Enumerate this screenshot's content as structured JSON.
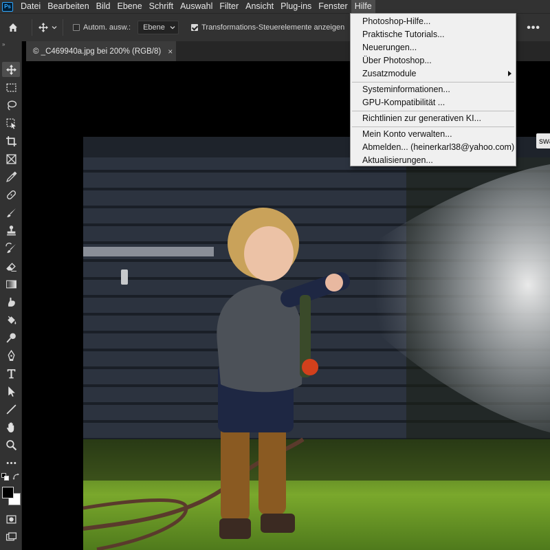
{
  "app": {
    "logo": "Ps"
  },
  "menubar": {
    "items": [
      "Datei",
      "Bearbeiten",
      "Bild",
      "Ebene",
      "Schrift",
      "Auswahl",
      "Filter",
      "Ansicht",
      "Plug-ins",
      "Fenster",
      "Hilfe"
    ],
    "active": "Hilfe"
  },
  "options": {
    "auto_select_label": "Autom. ausw.:",
    "auto_select_checked": false,
    "layer_select_value": "Ebene",
    "transform_controls_label": "Transformations-Steuerelemente anzeigen",
    "transform_controls_checked": true,
    "more_label": "•••"
  },
  "tab": {
    "title": "© _C469940a.jpg bei 200% (RGB/8)",
    "close": "×"
  },
  "canvas": {
    "partial_button_label": "swählen"
  },
  "help_menu": {
    "items": [
      {
        "label": "Photoshop-Hilfe..."
      },
      {
        "label": "Praktische Tutorials..."
      },
      {
        "label": "Neuerungen..."
      },
      {
        "label": "Über Photoshop..."
      },
      {
        "label": "Zusatzmodule",
        "submenu": true
      },
      {
        "label": "Systeminformationen..."
      },
      {
        "label": "GPU-Kompatibilität ..."
      },
      {
        "label": "Richtlinien zur generativen KI..."
      },
      {
        "label": "Mein Konto verwalten..."
      },
      {
        "label": "Abmelden... (heinerkarl38@yahoo.com)"
      },
      {
        "label": "Aktualisierungen..."
      }
    ]
  },
  "toolbar": {
    "collapse": "»",
    "tools": [
      "move-tool",
      "marquee-tool",
      "lasso-tool",
      "object-selection-tool",
      "crop-tool",
      "frame-tool",
      "eyedropper-tool",
      "healing-brush-tool",
      "brush-tool",
      "clone-stamp-tool",
      "history-brush-tool",
      "eraser-tool",
      "gradient-tool",
      "smudge-tool",
      "paint-bucket-tool",
      "dodge-tool",
      "pen-tool",
      "type-tool",
      "path-selection-tool",
      "line-tool",
      "hand-tool",
      "zoom-tool",
      "more-tools"
    ],
    "foreground_color": "#000000",
    "background_color": "#ffffff"
  }
}
